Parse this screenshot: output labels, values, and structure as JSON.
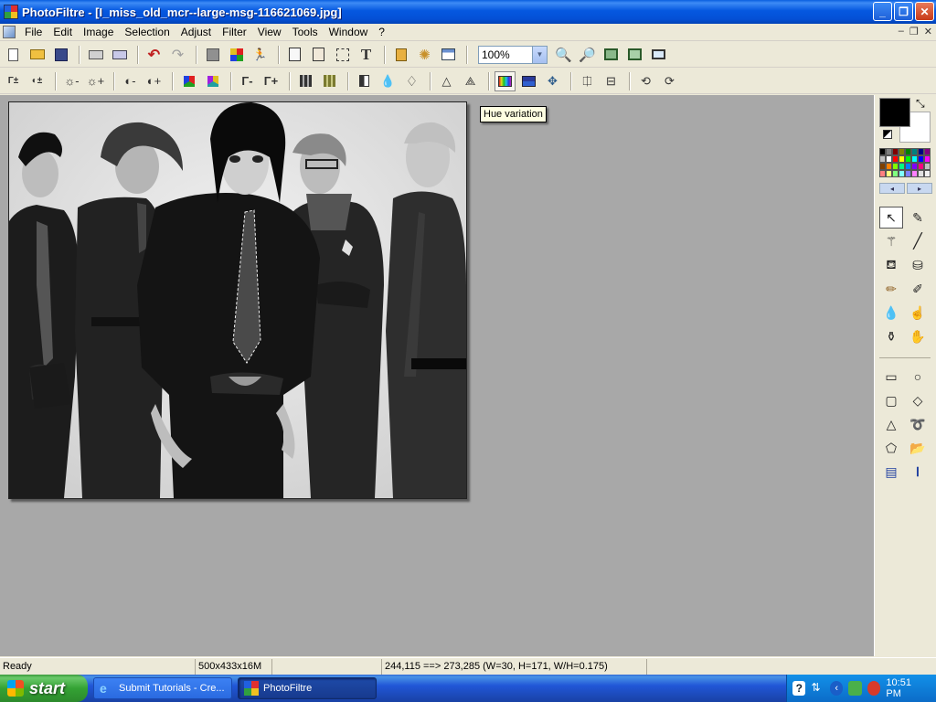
{
  "window": {
    "title": "PhotoFiltre - [I_miss_old_mcr--large-msg-116621069.jpg]"
  },
  "menu": {
    "items": [
      "File",
      "Edit",
      "Image",
      "Selection",
      "Adjust",
      "Filter",
      "View",
      "Tools",
      "Window",
      "?"
    ]
  },
  "toolbar": {
    "zoom_value": "100%"
  },
  "tooltip": {
    "text": "Hue variation"
  },
  "status": {
    "state": "Ready",
    "image_info": "500x433x16M",
    "selection_info": "244,115 ==> 273,285 (W=30, H=171, W/H=0.175)"
  },
  "taskbar": {
    "start_label": "start",
    "tasks": [
      "Submit Tutorials - Cre...",
      "PhotoFiltre"
    ],
    "clock": "10:51 PM"
  },
  "palette": {
    "foreground": "#000000",
    "background": "#ffffff",
    "swatches": [
      "#000000",
      "#808080",
      "#800000",
      "#808000",
      "#008000",
      "#008080",
      "#000080",
      "#800080",
      "#c0c0c0",
      "#ffffff",
      "#ff0000",
      "#ffff00",
      "#00ff00",
      "#00ffff",
      "#0000ff",
      "#ff00ff",
      "#804000",
      "#ff8000",
      "#80ff00",
      "#00ff80",
      "#0080ff",
      "#8000ff",
      "#ff0080",
      "#c0c0c0",
      "#ff8080",
      "#ffff80",
      "#80ff80",
      "#80ffff",
      "#8080ff",
      "#ff80ff",
      "#e0e0e0",
      "#f0f0f0"
    ]
  },
  "colors": {
    "titlebar": "#0558e0",
    "workspace": "#a8a8a8",
    "face": "#ece9d8"
  }
}
